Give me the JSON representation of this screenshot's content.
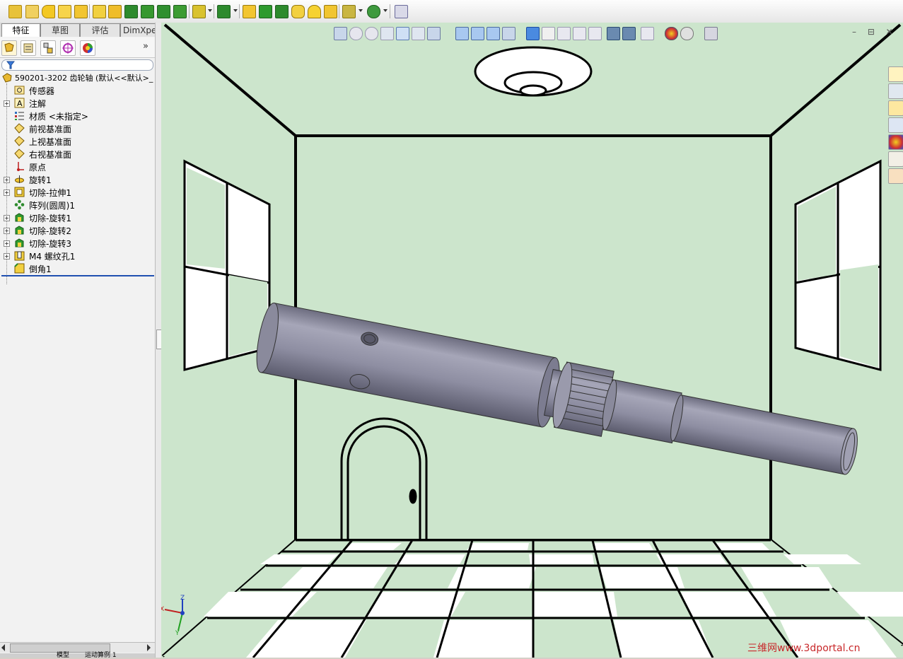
{
  "toolbar": {
    "icons": [
      "new-part-icon",
      "move-icon",
      "revolve-icon",
      "extrude-boss-icon",
      "sweep-icon",
      "cut-extrude-icon",
      "hole-wizard-icon",
      "loft-icon",
      "cut-revolve-icon",
      "cut-sweep-icon",
      "cut-loft-icon",
      "fillet-icon",
      "linear-pattern-icon",
      "rib-icon",
      "draft-icon",
      "shell-icon",
      "wrap-icon",
      "dome-icon",
      "reference-geometry-icon",
      "curves-icon",
      "instant3d-icon"
    ]
  },
  "left_panel": {
    "tabs": [
      {
        "label": "特征",
        "active": true
      },
      {
        "label": "草图",
        "active": false
      },
      {
        "label": "评估",
        "active": false
      },
      {
        "label": "DimXpert",
        "active": false
      }
    ],
    "manager_icons": [
      "featuremanager-icon",
      "propertymanager-icon",
      "configurationmanager-icon",
      "dimxpert-manager-icon",
      "display-manager-icon"
    ],
    "expand_arrows": "»",
    "tree": {
      "root": "590201-3202 齿轮轴  (默认<<默认>_",
      "items": [
        {
          "label": "传感器",
          "icon": "sensor-icon",
          "expandable": false
        },
        {
          "label": "注解",
          "icon": "annotation-icon",
          "expandable": true
        },
        {
          "label": "材质 <未指定>",
          "icon": "material-icon",
          "expandable": false
        },
        {
          "label": "前视基准面",
          "icon": "plane-icon",
          "expandable": false
        },
        {
          "label": "上视基准面",
          "icon": "plane-icon",
          "expandable": false
        },
        {
          "label": "右视基准面",
          "icon": "plane-icon",
          "expandable": false
        },
        {
          "label": "原点",
          "icon": "origin-icon",
          "expandable": false
        },
        {
          "label": "旋转1",
          "icon": "revolve-feature-icon",
          "expandable": true
        },
        {
          "label": "切除-拉伸1",
          "icon": "cut-extrude-feature-icon",
          "expandable": true
        },
        {
          "label": "阵列(圆周)1",
          "icon": "circular-pattern-icon",
          "expandable": false
        },
        {
          "label": "切除-旋转1",
          "icon": "cut-revolve-feature-icon",
          "expandable": true
        },
        {
          "label": "切除-旋转2",
          "icon": "cut-revolve-feature-icon",
          "expandable": true
        },
        {
          "label": "切除-旋转3",
          "icon": "cut-revolve-feature-icon",
          "expandable": true
        },
        {
          "label": "M4 螺纹孔1",
          "icon": "hole-feature-icon",
          "expandable": true
        },
        {
          "label": "倒角1",
          "icon": "chamfer-icon",
          "expandable": false
        }
      ]
    },
    "bottom_tabs": [
      "模型",
      "运动算例 1"
    ]
  },
  "viewport": {
    "headsup_icons": [
      "select-icon",
      "zoom-to-fit-icon",
      "zoom-to-area-icon",
      "previous-view-icon",
      "section-view-icon",
      "view-orientation-icon",
      "display-style-icon",
      "isometric-icon",
      "trimetric-icon",
      "dimetric-icon",
      "view-cube-icon",
      "shaded-with-edges-icon",
      "hidden-lines-icon",
      "perspective-icon",
      "shadows-icon",
      "ambient-occlusion-icon",
      "realview-icon",
      "cartoon-icon",
      "hide-show-items-icon",
      "appearance-icon",
      "scene-icon",
      "view-settings-icon"
    ],
    "window_controls": "– ⊟ ✕",
    "triad": {
      "x": "X",
      "y": "Y",
      "z": "Z"
    },
    "scene": "room-with-windows-and-door",
    "model": "gear-shaft"
  },
  "task_pane": {
    "icons": [
      "sw-resources-icon",
      "design-library-icon",
      "file-explorer-icon",
      "view-palette-icon",
      "appearances-scenes-icon",
      "custom-properties-icon",
      "sw-forum-icon"
    ]
  },
  "watermark": "三维网www.3dportal.cn",
  "colors": {
    "viewport_bg": "#cce5cc",
    "model": "#8e8ea2",
    "accent": "#2050b0"
  }
}
